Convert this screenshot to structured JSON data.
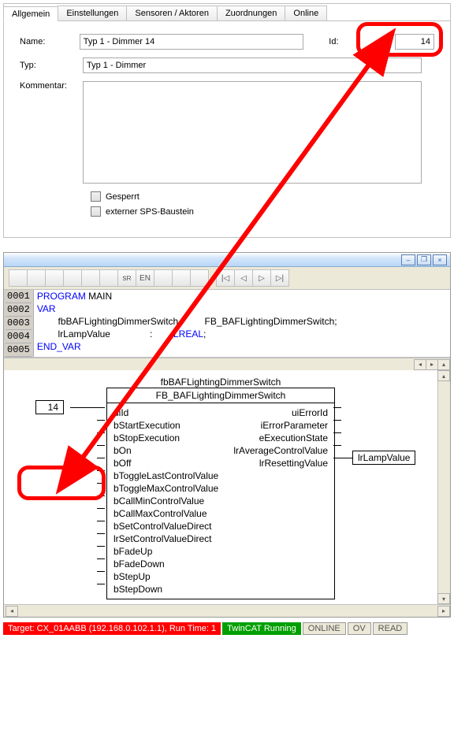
{
  "config": {
    "tabs": [
      "Allgemein",
      "Einstellungen",
      "Sensoren / Aktoren",
      "Zuordnungen",
      "Online"
    ],
    "active_tab": "Allgemein",
    "labels": {
      "name": "Name:",
      "typ": "Typ:",
      "kommentar": "Kommentar:",
      "id": "Id:"
    },
    "values": {
      "name": "Typ 1 - Dimmer 14",
      "typ": "Typ 1 - Dimmer",
      "kommentar": "",
      "id": "14"
    },
    "checks": {
      "gesperrt": "Gesperrt",
      "externer": "externer SPS-Baustein"
    }
  },
  "ide": {
    "gutter": [
      "0001",
      "0002",
      "0003",
      "0004",
      "0005"
    ],
    "code": {
      "l1_kw": "PROGRAM",
      "l1_rest": " MAIN",
      "l2_kw": "VAR",
      "l3": "        fbBAFLightingDimmerSwitch :        FB_BAFLightingDimmerSwitch;",
      "l4_a": "        lrLampValue               :        ",
      "l4_ty": "LREAL",
      "l4_b": ";",
      "l5_kw": "END_VAR"
    },
    "fb": {
      "instance": "fbBAFLightingDimmerSwitch",
      "type": "FB_BAFLightingDimmerSwitch",
      "left_pins": [
        "uiId",
        "bStartExecution",
        "bStopExecution",
        "bOn",
        "bOff",
        "bToggleLastControlValue",
        "bToggleMaxControlValue",
        "bCallMinControlValue",
        "bCallMaxControlValue",
        "bSetControlValueDirect",
        "lrSetControlValueDirect",
        "bFadeUp",
        "bFadeDown",
        "bStepUp",
        "bStepDown"
      ],
      "right_pins": [
        "uiErrorId",
        "iErrorParameter",
        "eExecutionState",
        "lrAverageControlValue",
        "lrResettingValue"
      ],
      "uiId_value": "14",
      "out_box": "lrLampValue"
    }
  },
  "status": {
    "target": "Target: CX_01AABB (192.168.0.102.1.1), Run Time: 1",
    "running": "TwinCAT Running",
    "online": "ONLINE",
    "ov": "OV",
    "read": "READ"
  }
}
